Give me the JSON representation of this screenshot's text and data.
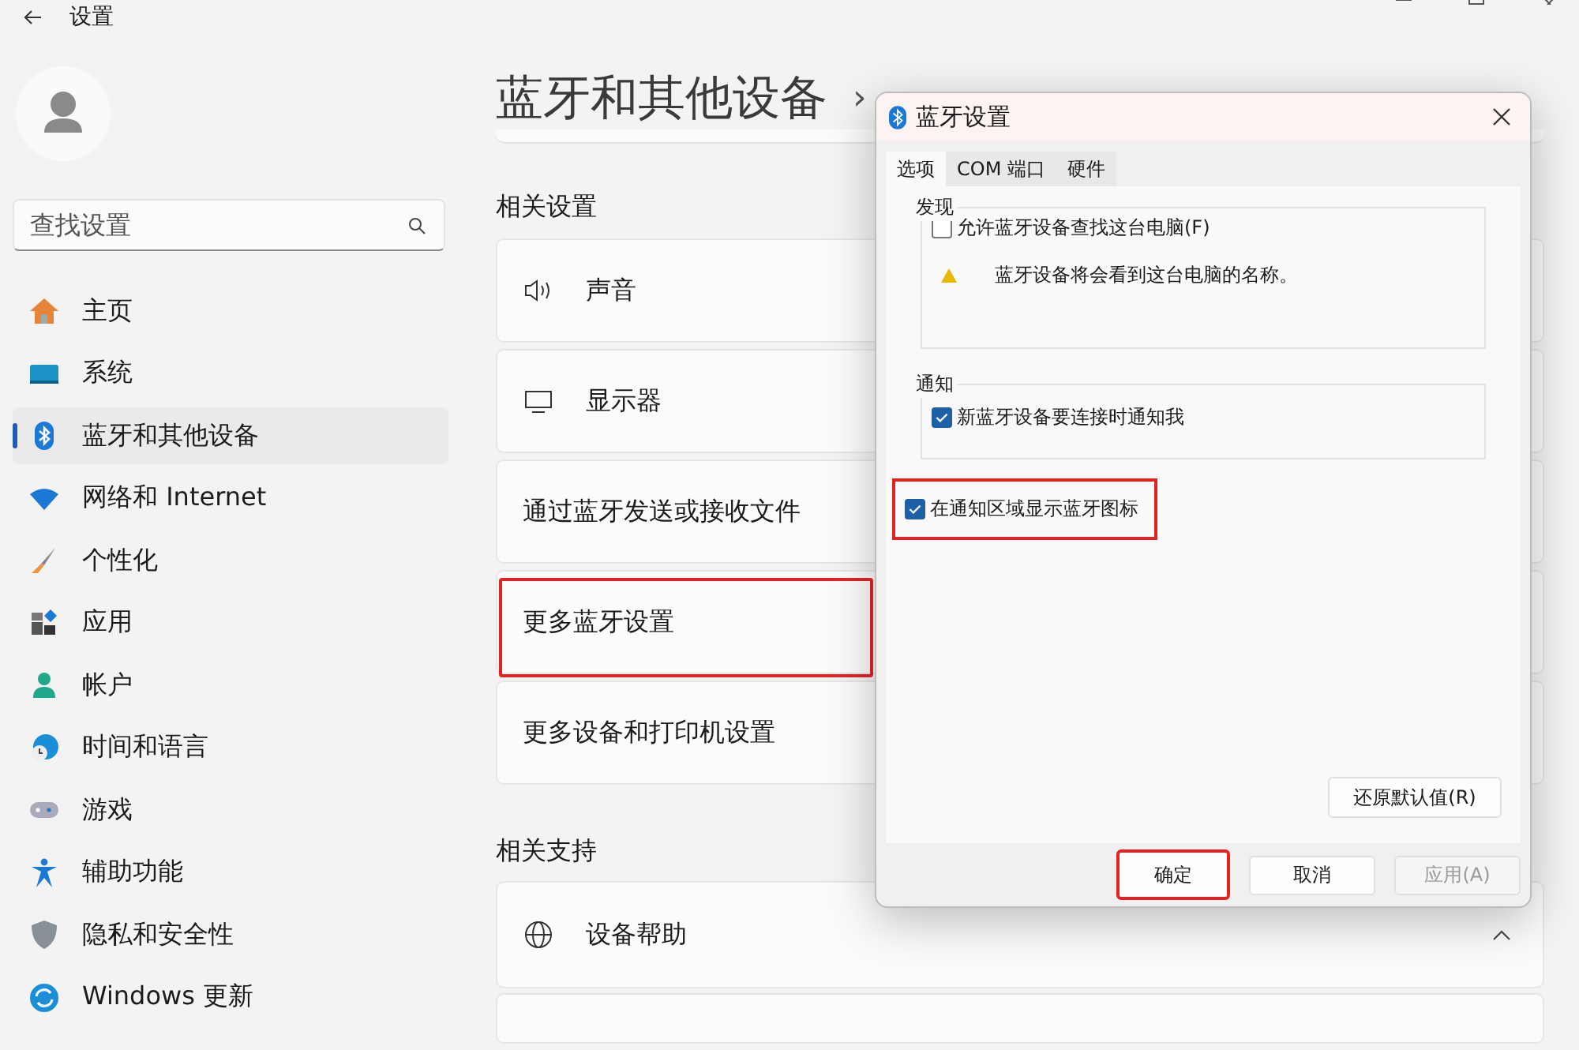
{
  "window": {
    "title": "设置"
  },
  "sidebar": {
    "search": {
      "placeholder": "查找设置"
    },
    "items": [
      {
        "label": "主页",
        "selected": false
      },
      {
        "label": "系统",
        "selected": false
      },
      {
        "label": "蓝牙和其他设备",
        "selected": true
      },
      {
        "label": "网络和 Internet",
        "selected": false
      },
      {
        "label": "个性化",
        "selected": false
      },
      {
        "label": "应用",
        "selected": false
      },
      {
        "label": "帐户",
        "selected": false
      },
      {
        "label": "时间和语言",
        "selected": false
      },
      {
        "label": "游戏",
        "selected": false
      },
      {
        "label": "辅助功能",
        "selected": false
      },
      {
        "label": "隐私和安全性",
        "selected": false
      },
      {
        "label": "Windows 更新",
        "selected": false
      }
    ]
  },
  "page": {
    "title": "蓝牙和其他设备",
    "breadcrumb_separator": "›",
    "related_settings": {
      "heading": "相关设置",
      "items": [
        {
          "label": "声音",
          "highlighted": false
        },
        {
          "label": "显示器",
          "highlighted": false
        },
        {
          "label": "通过蓝牙发送或接收文件",
          "highlighted": false
        },
        {
          "label": "更多蓝牙设置",
          "highlighted": true
        },
        {
          "label": "更多设备和打印机设置",
          "highlighted": false
        }
      ]
    },
    "related_support": {
      "heading": "相关支持",
      "items": [
        {
          "label": "设备帮助",
          "expanded": true
        }
      ]
    }
  },
  "dialog": {
    "title": "蓝牙设置",
    "tabs": [
      {
        "label": "选项",
        "selected": true
      },
      {
        "label": "COM 端口",
        "selected": false
      },
      {
        "label": "硬件",
        "selected": false
      }
    ],
    "discovery": {
      "heading": "发现",
      "checkbox": {
        "label": "允许蓝牙设备查找这台电脑(F)",
        "checked": false
      },
      "warning": "蓝牙设备将会看到这台电脑的名称。"
    },
    "notifications": {
      "heading": "通知",
      "checkbox": {
        "label": "新蓝牙设备要连接时通知我",
        "checked": true
      }
    },
    "tray_icon": {
      "label": "在通知区域显示蓝牙图标",
      "checked": true,
      "highlighted": true
    },
    "restore_button": "还原默认值(R)",
    "buttons": [
      {
        "label": "确定",
        "disabled": false,
        "highlighted": true
      },
      {
        "label": "取消",
        "disabled": false,
        "highlighted": false
      },
      {
        "label": "应用(A)",
        "disabled": true,
        "highlighted": false
      }
    ]
  }
}
